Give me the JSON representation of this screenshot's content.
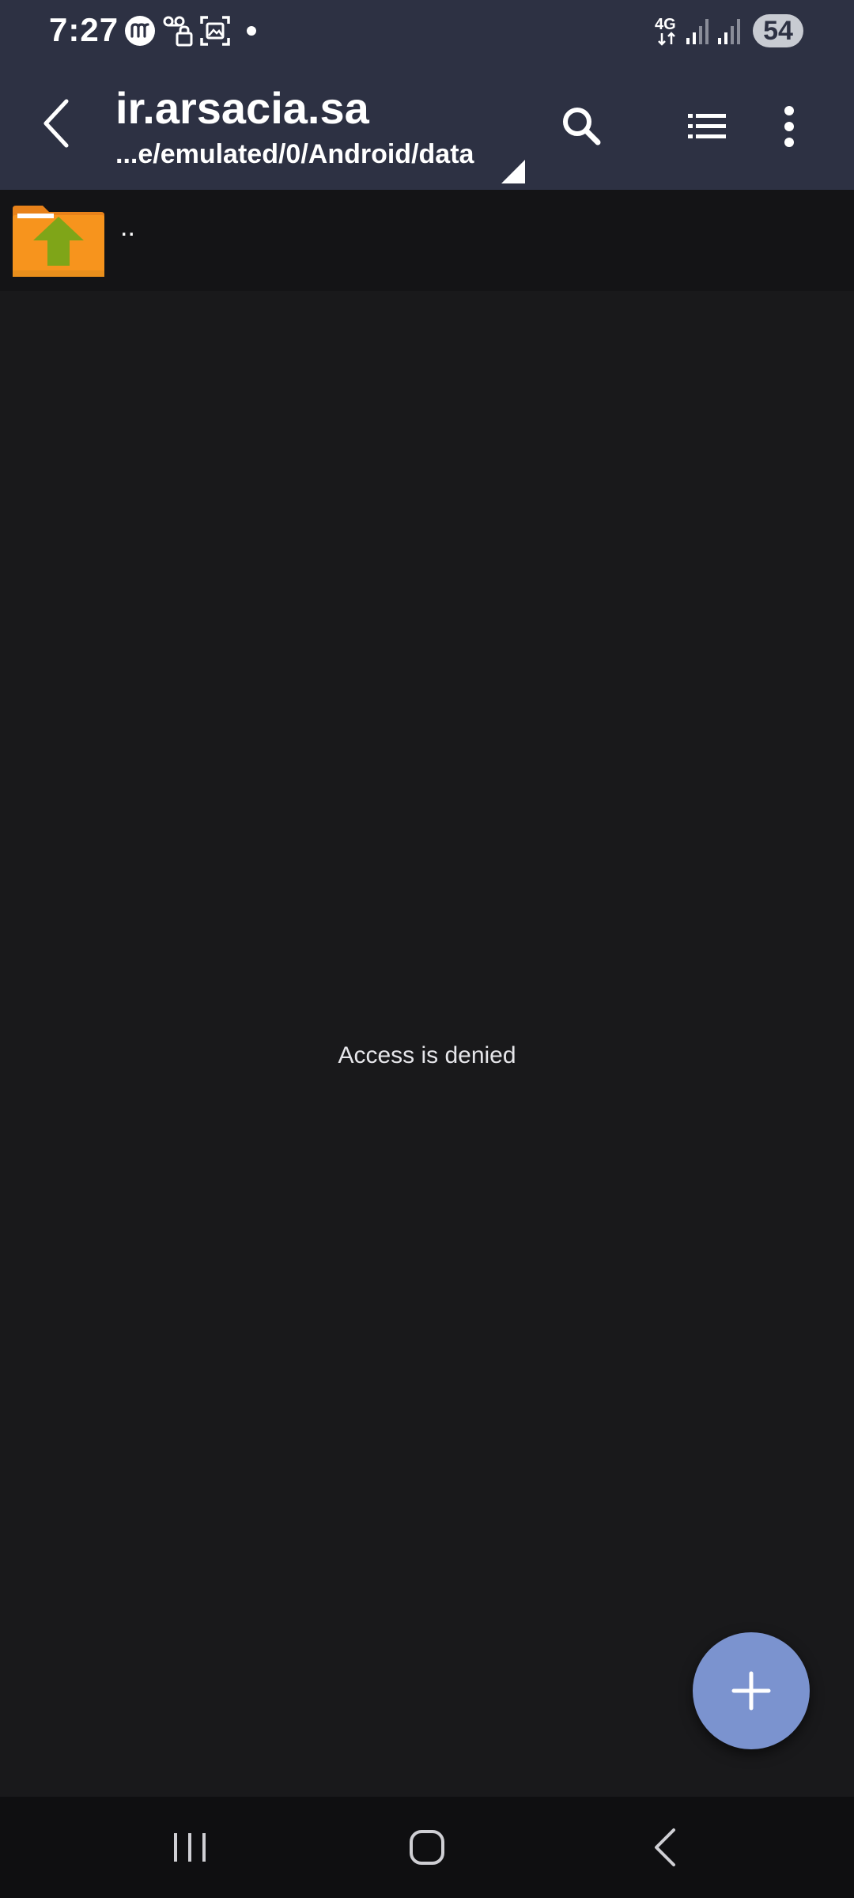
{
  "status_bar": {
    "time": "7:27",
    "network_type": "4G",
    "battery": "54",
    "icons": [
      "messenger-icon",
      "voicemail-lock-icon",
      "screenshot-icon",
      "dot-indicator",
      "network-4g-icon",
      "signal-icon",
      "signal-icon"
    ]
  },
  "app_bar": {
    "title": "ir.arsacia.sa",
    "path": "...e/emulated/0/Android/data",
    "actions": [
      "back-icon",
      "search-icon",
      "list-view-icon",
      "more-vert-icon"
    ]
  },
  "file_list": {
    "items": [
      {
        "label": "..",
        "icon": "folder-up-icon"
      }
    ]
  },
  "empty_message": "Access is denied",
  "fab": {
    "icon": "plus-icon"
  },
  "nav_bar": {
    "buttons": [
      "recents-icon",
      "home-icon",
      "back-icon"
    ]
  },
  "colors": {
    "app_bar_bg": "#2d3143",
    "content_bg": "#19191b",
    "fab_bg": "#7b93cf",
    "folder_orange": "#f7941d",
    "arrow_green": "#7fa518"
  }
}
